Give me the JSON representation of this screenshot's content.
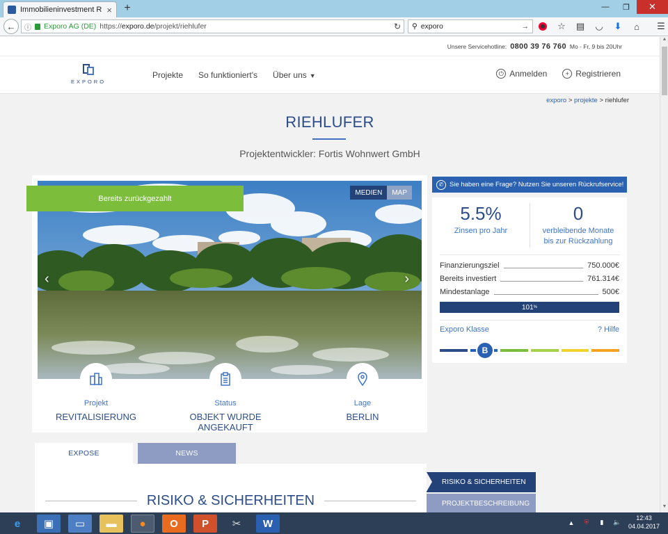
{
  "browser": {
    "tab_title": "Immobilieninvestment Rie...",
    "new_tab": "+",
    "site_identity": "Exporo AG (DE)",
    "url_prefix": "https://",
    "url_domain": "exporo.de",
    "url_path": "/projekt/riehlufer",
    "search_value": "exporo"
  },
  "hotline": {
    "label": "Unsere Servicehotline:",
    "number": "0800 39 76 760",
    "hours": "Mo - Fr, 9 bis 20Uhr"
  },
  "header": {
    "logo_text": "EXPORO",
    "nav": [
      "Projekte",
      "So funktioniert's",
      "Über uns"
    ],
    "login": "Anmelden",
    "register": "Registrieren"
  },
  "breadcrumb": {
    "home": "exporo",
    "sep": ">",
    "section": "projekte",
    "current": "riehlufer"
  },
  "project": {
    "title": "RIEHLUFER",
    "developer": "Projektentwickler: Fortis Wohnwert GmbH",
    "ribbon": "Bereits zurückgezahlt",
    "media_tab": "MEDIEN",
    "map_tab": "MAP",
    "facts": [
      {
        "label": "Projekt",
        "value": "REVITALISIERUNG",
        "icon": "building-icon"
      },
      {
        "label": "Status",
        "value": "OBJEKT WURDE ANGEKAUFT",
        "icon": "clipboard-icon"
      },
      {
        "label": "Lage",
        "value": "BERLIN",
        "icon": "map-pin-icon"
      }
    ]
  },
  "sidebar": {
    "callback": "Sie haben eine Frage? Nutzen Sie unseren Rückrufservice!",
    "interest_value": "5.5%",
    "interest_label": "Zinsen pro Jahr",
    "months_value": "0",
    "months_label_1": "verbleibende Monate",
    "months_label_2": "bis zur Rückzahlung",
    "rows": [
      {
        "label": "Finanzierungsziel",
        "value": "750.000€"
      },
      {
        "label": "Bereits investiert",
        "value": "761.314€"
      },
      {
        "label": "Mindestanlage",
        "value": "500€"
      }
    ],
    "progress_value": "101",
    "progress_unit": "%",
    "progress_fraction": 1.0,
    "klasse_label": "Exporo Klasse",
    "help_label": "? Hilfe",
    "klasse_badge": "B",
    "scale_colors": [
      "#2c4d8a",
      "#2a62b1",
      "#7cbd3c",
      "#a9d04a",
      "#f0d22c",
      "#f4a420"
    ]
  },
  "content": {
    "tabs": [
      "EXPOSE",
      "NEWS"
    ],
    "section_title": "RISIKO & SICHERHEITEN",
    "side_menu": [
      "RISIKO & SICHERHEITEN",
      "PROJEKTBESCHREIBUNG"
    ]
  },
  "taskbar": {
    "time": "12:43",
    "date": "04.04.2017"
  }
}
